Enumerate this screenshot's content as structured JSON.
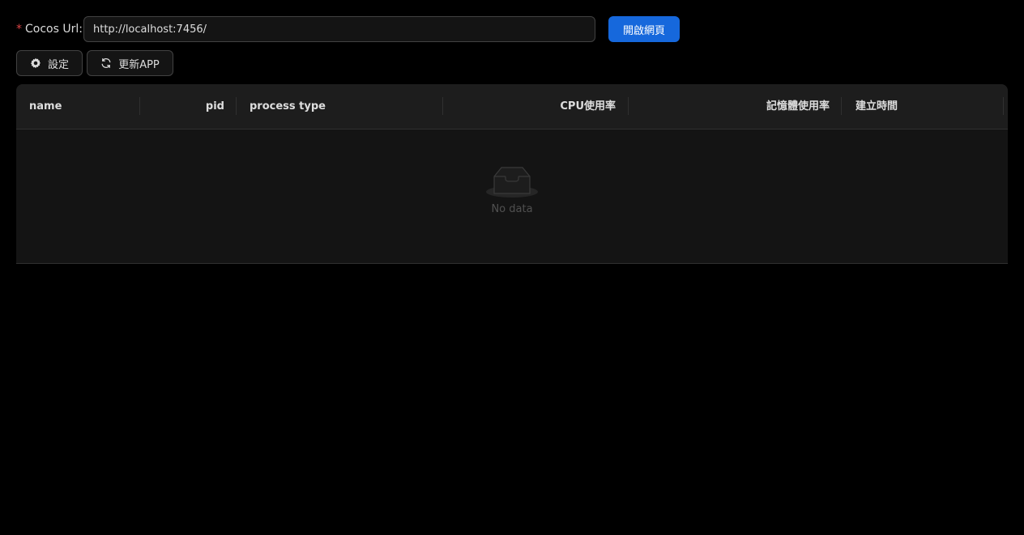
{
  "form": {
    "required_mark": "*",
    "label": "Cocos Url:",
    "url_value": "http://localhost:7456/",
    "open_button_label": "開啟網頁"
  },
  "toolbar": {
    "settings_label": "設定",
    "settings_icon": "gear-icon",
    "update_label": "更新APP",
    "update_icon": "sync-icon"
  },
  "table": {
    "columns": [
      {
        "key": "name",
        "label": "name",
        "align": "left"
      },
      {
        "key": "pid",
        "label": "pid",
        "align": "right"
      },
      {
        "key": "process_type",
        "label": "process type",
        "align": "left"
      },
      {
        "key": "cpu",
        "label": "CPU使用率",
        "align": "right"
      },
      {
        "key": "memory",
        "label": "記憶體使用率",
        "align": "right"
      },
      {
        "key": "created",
        "label": "建立時間",
        "align": "left"
      }
    ],
    "rows": [],
    "empty_text": "No data",
    "empty_icon": "inbox-icon"
  },
  "colors": {
    "primary": "#1668dc",
    "required": "#dc4446",
    "background": "#000000",
    "table_header": "#1d1d1d",
    "table_body": "#141414"
  }
}
